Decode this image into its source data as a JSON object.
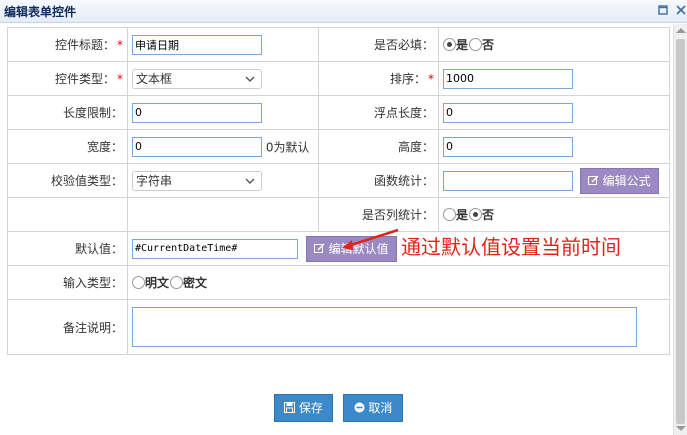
{
  "window": {
    "title": "编辑表单控件"
  },
  "form": {
    "control_title": {
      "label": "控件标题：",
      "value": "申请日期"
    },
    "required": {
      "label": "是否必填：",
      "opt_yes": "是",
      "opt_no": "否",
      "selected": "是"
    },
    "control_type": {
      "label": "控件类型：",
      "value": "文本框"
    },
    "sort": {
      "label": "排序：",
      "value": "1000"
    },
    "length_limit": {
      "label": "长度限制：",
      "value": "0"
    },
    "float_length": {
      "label": "浮点长度：",
      "value": "0"
    },
    "width": {
      "label": "宽度：",
      "value": "0",
      "hint": "0为默认"
    },
    "height": {
      "label": "高度：",
      "value": "0"
    },
    "validate_type": {
      "label": "校验值类型：",
      "value": "字符串"
    },
    "func_stat": {
      "label": "函数统计：",
      "value": "",
      "button": "编辑公式"
    },
    "column_stat": {
      "label": "是否列统计：",
      "opt_yes": "是",
      "opt_no": "否",
      "selected": "否"
    },
    "default_value": {
      "label": "默认值：",
      "value": "#CurrentDateTime#",
      "button": "编辑默认值"
    },
    "input_type": {
      "label": "输入类型：",
      "opt_plain": "明文",
      "opt_secret": "密文"
    },
    "remark": {
      "label": "备注说明：",
      "value": ""
    }
  },
  "annotation": "通过默认值设置当前时间",
  "buttons": {
    "save": "保存",
    "cancel": "取消"
  },
  "colors": {
    "accent_purple": "#9b89c4",
    "accent_blue": "#3b89c9",
    "required_red": "#e00000",
    "note_red": "#e2231a"
  }
}
